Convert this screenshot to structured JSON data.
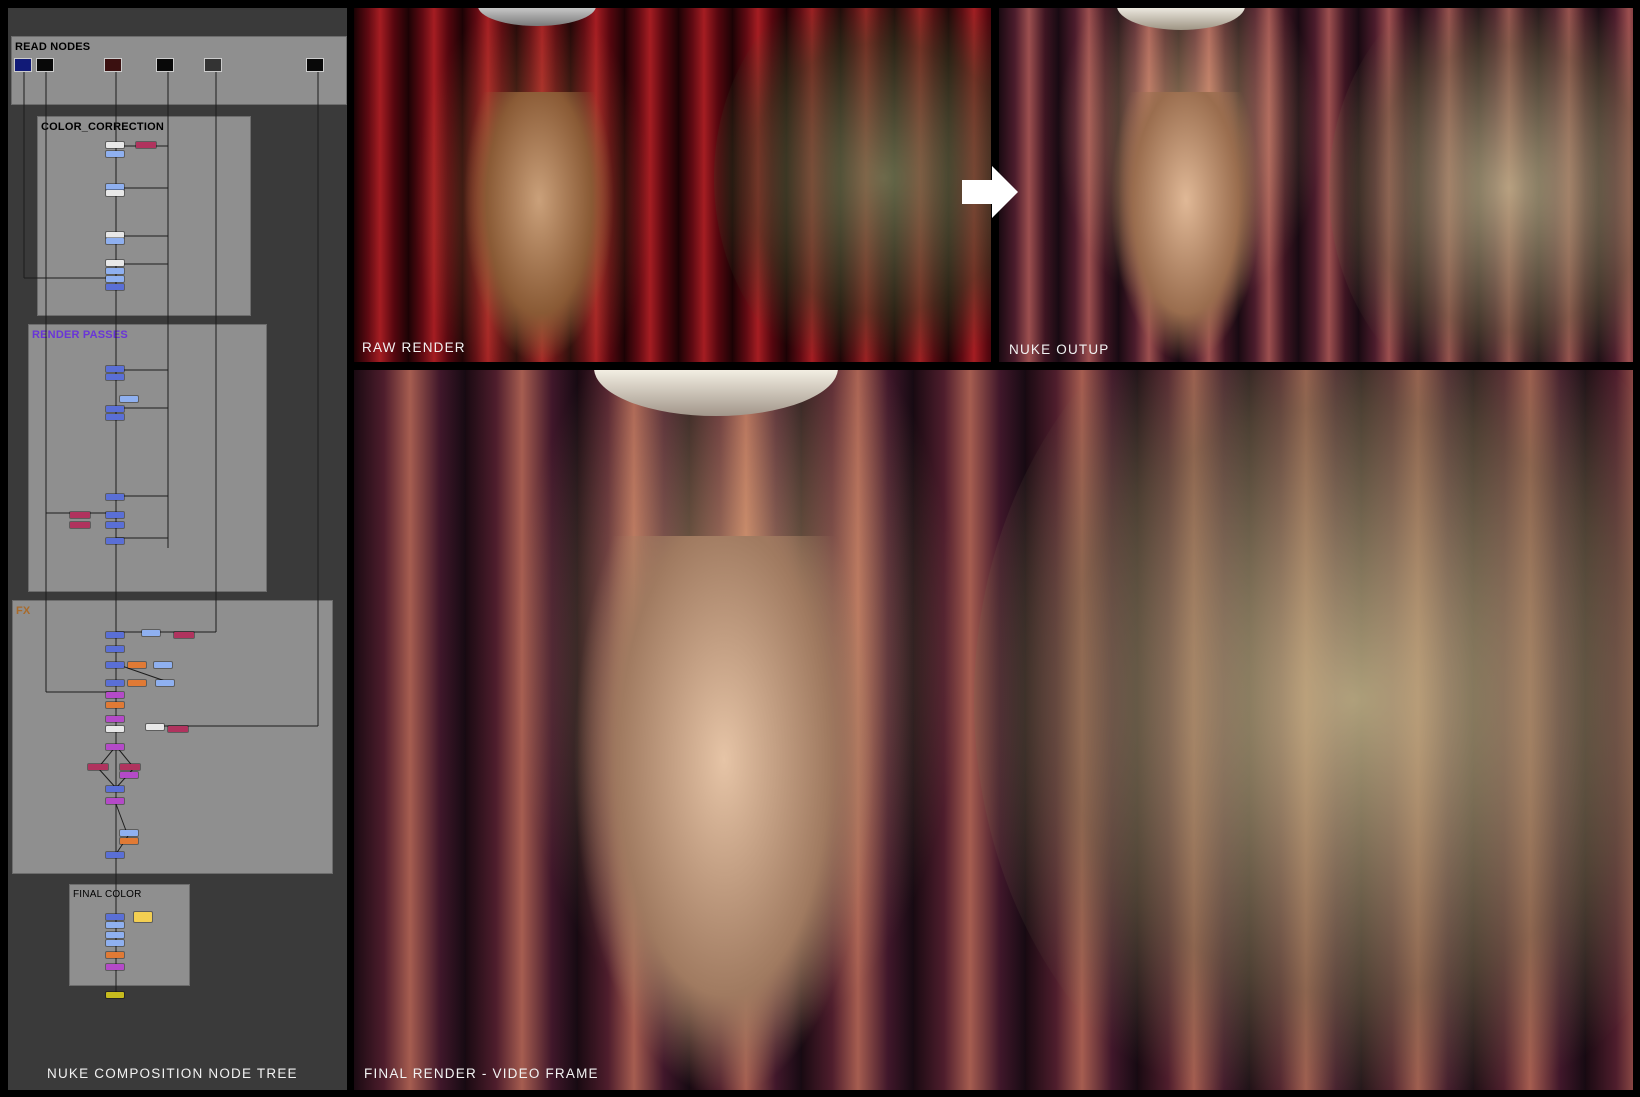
{
  "node_panel": {
    "caption": "NUKE COMPOSITION NODE TREE",
    "groups": {
      "read_nodes": {
        "label": "READ NODES",
        "color": "#111111"
      },
      "color_correction": {
        "label": "COLOR_CORRECTION",
        "color": "#111111"
      },
      "render_passes": {
        "label": "RENDER PASSES",
        "color": "#6a35d8"
      },
      "fx": {
        "label": "FX",
        "color": "#a86a2a"
      },
      "final_color": {
        "label": "FINAL COLOR",
        "color": "#111111"
      }
    }
  },
  "images": {
    "raw_render": {
      "caption": "RAW RENDER"
    },
    "nuke_output": {
      "caption": "NUKE OUTUP"
    },
    "final_render": {
      "caption": "FINAL RENDER - VIDEO FRAME"
    }
  },
  "icons": {
    "flow_arrow": "right-arrow-icon"
  },
  "colors": {
    "panel_bg": "#3a3a3a",
    "backdrop": "#8f8f8f",
    "node_blue": "#5a6fd6",
    "node_pink": "#b0335e",
    "node_orange": "#e07a35"
  }
}
